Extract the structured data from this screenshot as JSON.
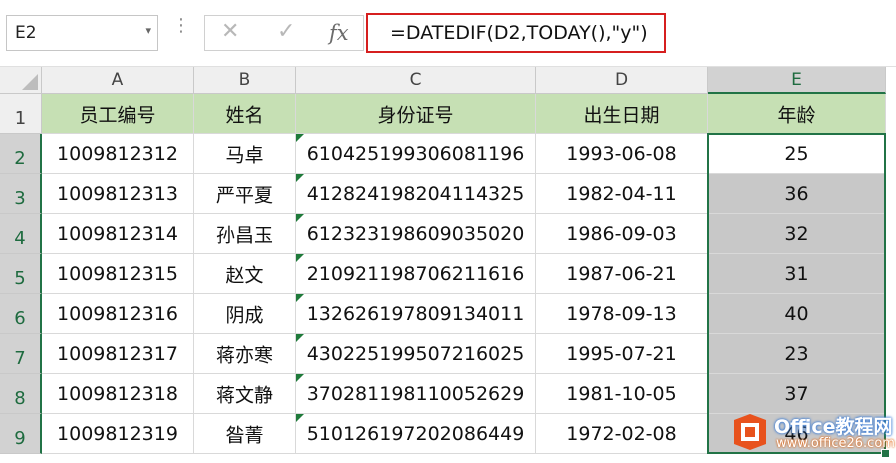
{
  "formula_bar": {
    "name_box_value": "E2",
    "cancel_icon": "close-icon",
    "enter_icon": "check-icon",
    "fx_label": "fx",
    "formula": "=DATEDIF(D2,TODAY(),\"y\")"
  },
  "columns": [
    "A",
    "B",
    "C",
    "D",
    "E"
  ],
  "rows": [
    "1",
    "2",
    "3",
    "4",
    "5",
    "6",
    "7",
    "8",
    "9"
  ],
  "selected_column": "E",
  "header_row": [
    "员工编号",
    "姓名",
    "身份证号",
    "出生日期",
    "年龄"
  ],
  "data_rows": [
    [
      "1009812312",
      "马卓",
      "610425199306081196",
      "1993-06-08",
      "25"
    ],
    [
      "1009812313",
      "严平夏",
      "412824198204114325",
      "1982-04-11",
      "36"
    ],
    [
      "1009812314",
      "孙昌玉",
      "612323198609035020",
      "1986-09-03",
      "32"
    ],
    [
      "1009812315",
      "赵文",
      "210921198706211616",
      "1987-06-21",
      "31"
    ],
    [
      "1009812316",
      "阴成",
      "132626197809134011",
      "1978-09-13",
      "40"
    ],
    [
      "1009812317",
      "蒋亦寒",
      "430225199507216025",
      "1995-07-21",
      "23"
    ],
    [
      "1009812318",
      "蒋文静",
      "370281198110052629",
      "1981-10-05",
      "37"
    ],
    [
      "1009812319",
      "昝菁",
      "510126197202086449",
      "1972-02-08",
      "46"
    ]
  ],
  "colors": {
    "header_fill": "#c6e0b4",
    "selection_fill": "#c8c8c8",
    "selection_border": "#217346",
    "formula_highlight": "#d61f1f"
  },
  "watermark": {
    "brand": "Office教程网",
    "url": "www.office26.com"
  }
}
